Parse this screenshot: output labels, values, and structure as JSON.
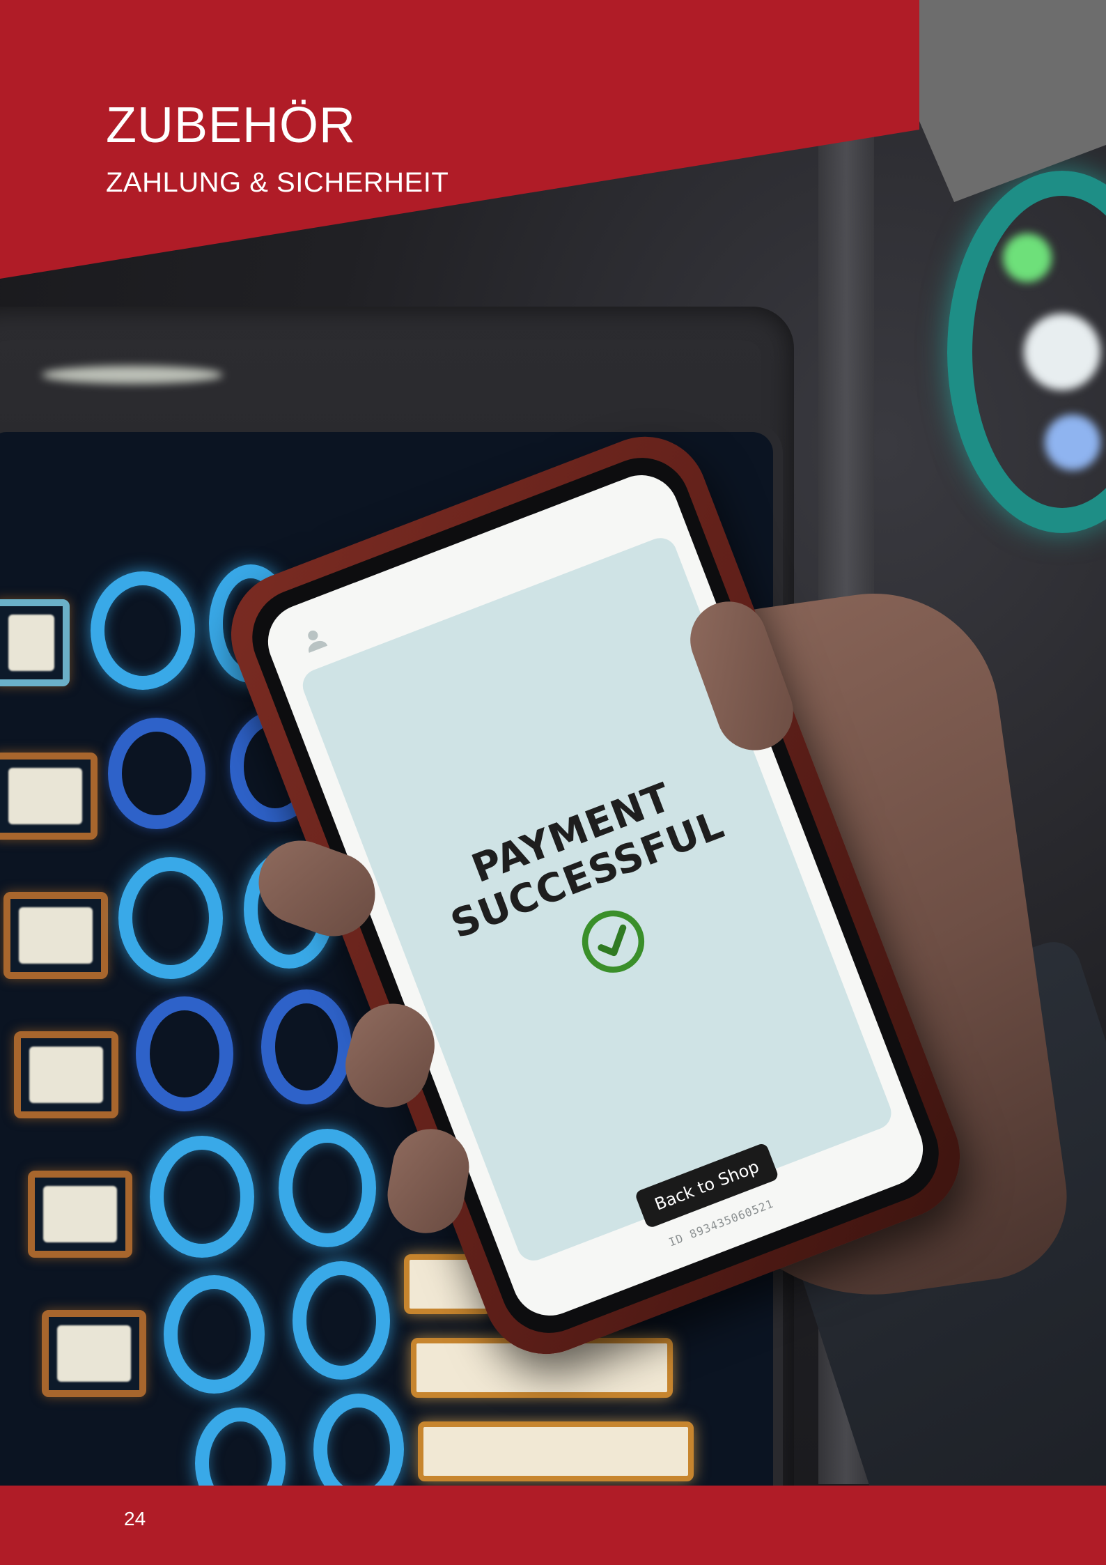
{
  "header": {
    "title": "ZUBEHÖR",
    "subtitle": "ZAHLUNG & SICHERHEIT"
  },
  "phone_screen": {
    "headline": "PAYMENT SUCCESSFUL",
    "status_icon": "check-circle-icon",
    "back_button_label": "Back to Shop",
    "transaction_id": "ID 89343506052​1"
  },
  "footer": {
    "page_number": "24"
  },
  "colors": {
    "brand_red": "#b01c27",
    "accent_gray": "#6d6d6d",
    "success_green": "#3a8f2a"
  }
}
